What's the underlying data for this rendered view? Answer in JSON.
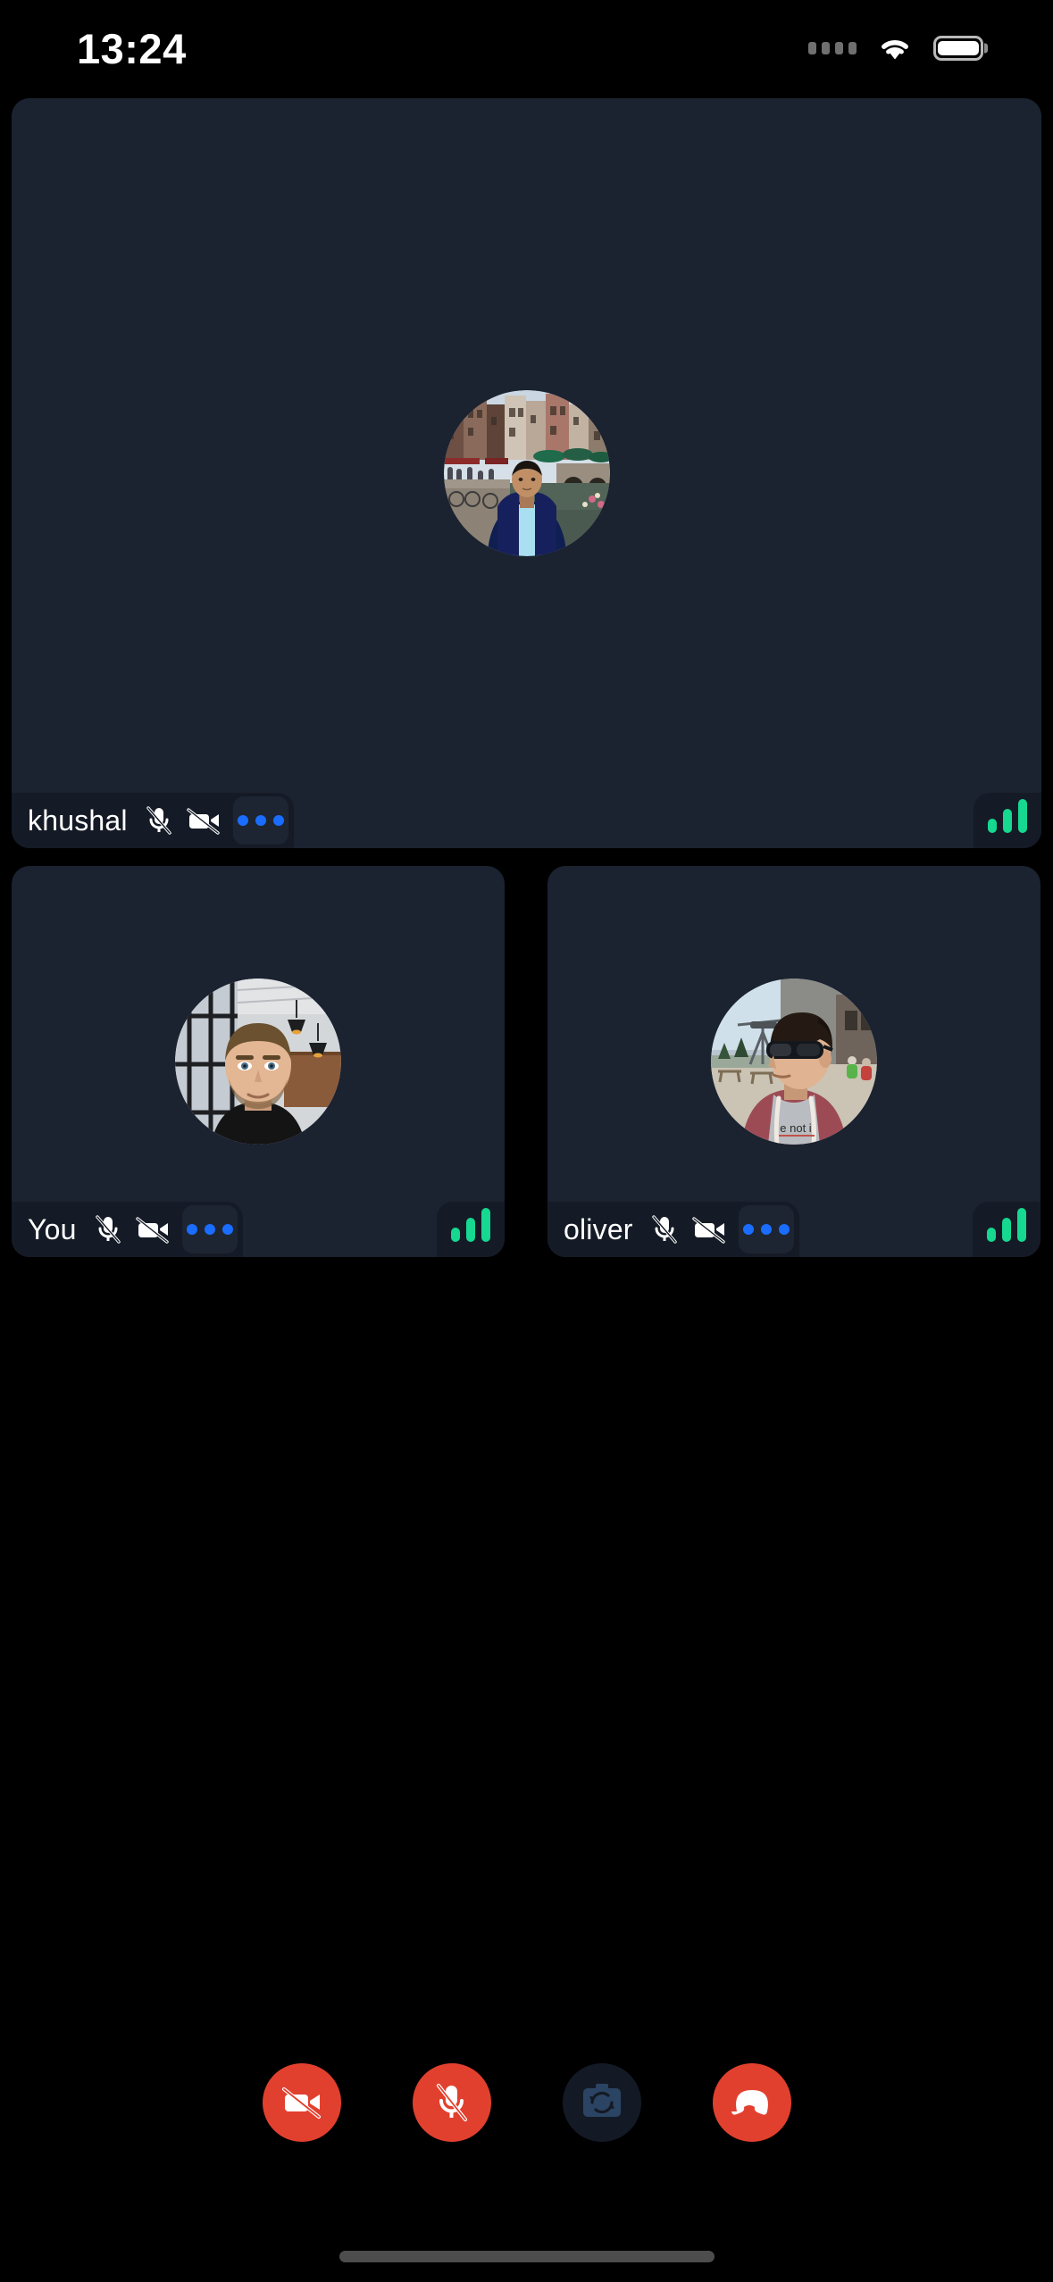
{
  "status_bar": {
    "time": "13:24",
    "signal_icon": "signal-dots-icon",
    "wifi_icon": "wifi-icon",
    "battery_icon": "battery-full-icon"
  },
  "call": {
    "participants": [
      {
        "name": "khushal",
        "position": "main",
        "mic_icon": "mic-off-icon",
        "mic_muted": true,
        "video_icon": "video-off-icon",
        "video_muted": true,
        "more_icon": "more-options-icon",
        "signal_icon": "signal-strength-icon",
        "signal_bars": 3,
        "avatar": "avatar-khushal",
        "avatar_description": "person standing by a canal with historic row houses"
      },
      {
        "name": "You",
        "position": "bottom-left",
        "mic_icon": "mic-off-icon",
        "mic_muted": true,
        "video_icon": "video-off-icon",
        "video_muted": true,
        "more_icon": "more-options-icon",
        "signal_icon": "signal-strength-icon",
        "signal_bars": 3,
        "avatar": "avatar-you",
        "avatar_description": "man in black shirt in modern interior with pendant lamps"
      },
      {
        "name": "oliver",
        "position": "bottom-right",
        "mic_icon": "mic-off-icon",
        "mic_muted": true,
        "video_icon": "video-off-icon",
        "video_muted": true,
        "more_icon": "more-options-icon",
        "signal_icon": "signal-strength-icon",
        "signal_bars": 3,
        "avatar": "avatar-oliver",
        "avatar_description": "man with sunglasses in maroon hoodie outdoors"
      }
    ]
  },
  "controls": [
    {
      "id": "toggle-video",
      "icon": "video-off-icon",
      "label": "Turn camera on",
      "style": "danger"
    },
    {
      "id": "toggle-mic",
      "icon": "mic-off-icon",
      "label": "Unmute",
      "style": "danger"
    },
    {
      "id": "flip-camera",
      "icon": "camera-flip-icon",
      "label": "Switch camera",
      "style": "neutral"
    },
    {
      "id": "end-call",
      "icon": "end-call-icon",
      "label": "End call",
      "style": "danger"
    }
  ],
  "colors": {
    "background": "#000000",
    "tile": "#1b2230",
    "pill": "#151b26",
    "accent_blue": "#1a6dff",
    "signal_green": "#16d890",
    "danger_red": "#e2402e",
    "flip_icon": "#2b4463"
  },
  "home_indicator": "home-indicator"
}
